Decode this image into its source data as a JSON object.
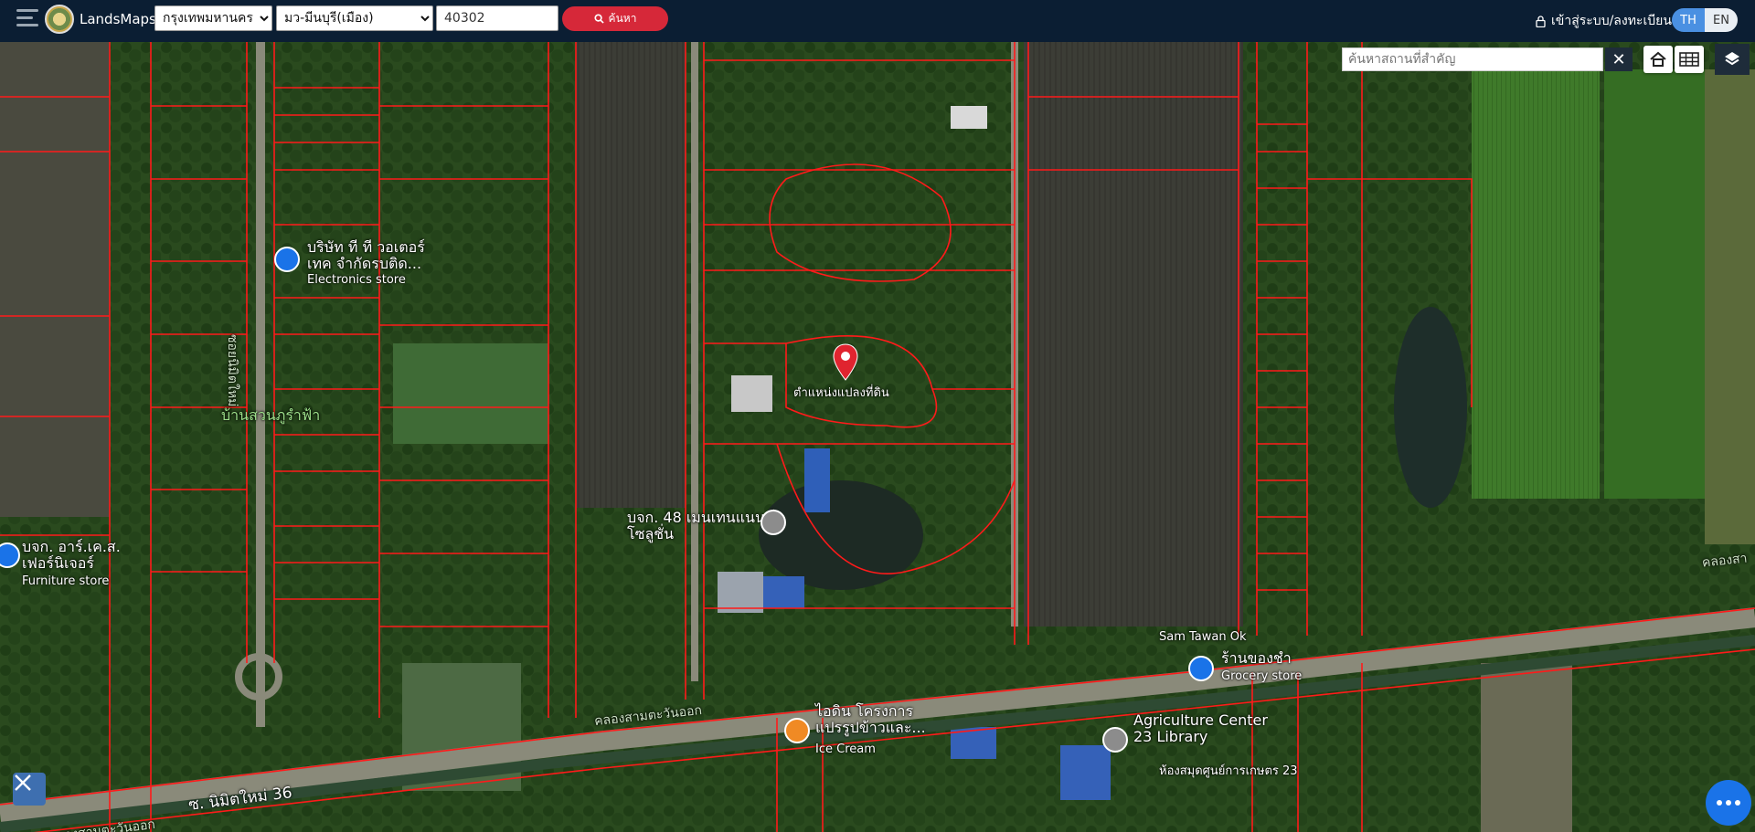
{
  "header": {
    "brand": "LandsMaps",
    "province_selected": "กรุงเทพมหานคร",
    "district_selected": "มว-มีนบุรี(เมือง)",
    "parcel_value": "40302",
    "search_label": "ค้นหา",
    "login_label": "เข้าสู่ระบบ/ลงทะเบียน",
    "lang_th": "TH",
    "lang_en": "EN"
  },
  "map_controls": {
    "place_search_placeholder": "ค้นหาสถานที่สำคัญ",
    "clear_label": "✕"
  },
  "map": {
    "pin_label": "ตำแหน่งแปลงที่ดิน",
    "places": [
      {
        "name": "บริษัท ที ที วอเตอร์ เทค จำกัดรบติด...",
        "type": "Electronics store"
      },
      {
        "name": "บ้านสวนภูรำฟ้า",
        "type": ""
      },
      {
        "name": "บจก. อาร์.เค.ส. เฟอร์นิเจอร์",
        "type": "Furniture store"
      },
      {
        "name": "บจก. 48 เมนเทนแนนซ์ โซลูชั่น",
        "type": ""
      },
      {
        "name": "Sam Tawan Ok",
        "type": ""
      },
      {
        "name": "ร้านของชำ",
        "type": "Grocery store"
      },
      {
        "name": "ไอดิน โครงการ แปรรูปข้าวและ...",
        "type": "Ice Cream"
      },
      {
        "name": "Agriculture Center 23 Library",
        "type": "ห้องสมุดศูนย์การเกษตร 23"
      }
    ],
    "roads": [
      "ซอยนิมิตใหม่",
      "ซ. นิมิตใหม่ 36",
      "คลองสามตะวันออก",
      "คลองสามตะวันออก",
      "คลองสา"
    ]
  },
  "colors": {
    "topbar": "#0b1e33",
    "search_button": "#d62839",
    "parcel_lines": "#ff1a1a",
    "accent_blue": "#1a73e8"
  }
}
